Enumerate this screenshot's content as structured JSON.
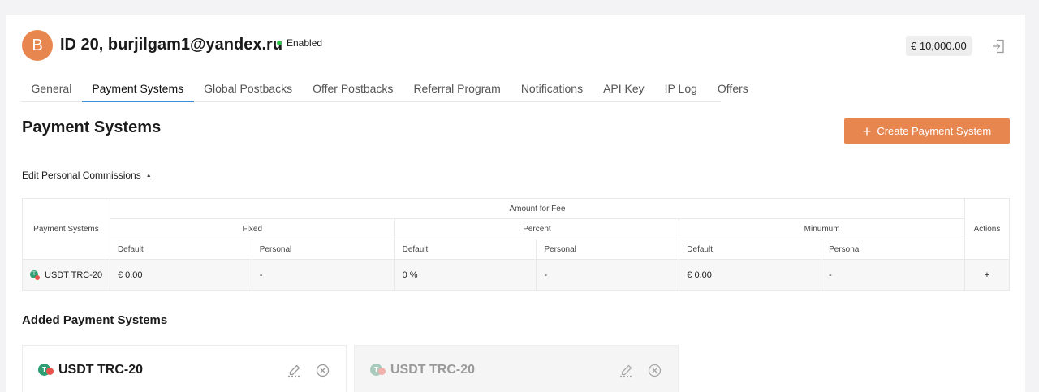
{
  "header": {
    "avatar_letter": "B",
    "title": "ID 20, burjilgam1@yandex.ru",
    "status": "Enabled",
    "balance": "€ 10,000.00"
  },
  "tabs": [
    {
      "label": "General"
    },
    {
      "label": "Payment Systems",
      "active": true
    },
    {
      "label": "Global Postbacks"
    },
    {
      "label": "Offer Postbacks"
    },
    {
      "label": "Referral Program"
    },
    {
      "label": "Notifications"
    },
    {
      "label": "API Key"
    },
    {
      "label": "IP Log"
    },
    {
      "label": "Offers"
    }
  ],
  "page": {
    "title": "Payment Systems",
    "create_button": "Create Payment System",
    "edit_commissions": "Edit Personal Commissions",
    "added_title": "Added Payment Systems"
  },
  "table": {
    "col_payment_systems": "Payment Systems",
    "col_amount_for_fee": "Amount for Fee",
    "col_fixed": "Fixed",
    "col_percent": "Percent",
    "col_minimum": "Minumum",
    "col_actions": "Actions",
    "sub_default": "Default",
    "sub_personal": "Personal",
    "row": {
      "name": "USDT TRC-20",
      "fixed_default": "€ 0.00",
      "fixed_personal": "-",
      "percent_default": "0 %",
      "percent_personal": "-",
      "minimum_default": "€ 0.00",
      "minimum_personal": "-"
    }
  },
  "added_systems": [
    {
      "name": "USDT TRC-20",
      "enabled": true
    },
    {
      "name": "USDT TRC-20",
      "enabled": false
    }
  ],
  "colors": {
    "accent": "#e8864f",
    "tab_active": "#3a8fd8",
    "status_enabled": "#2fbf4a"
  }
}
